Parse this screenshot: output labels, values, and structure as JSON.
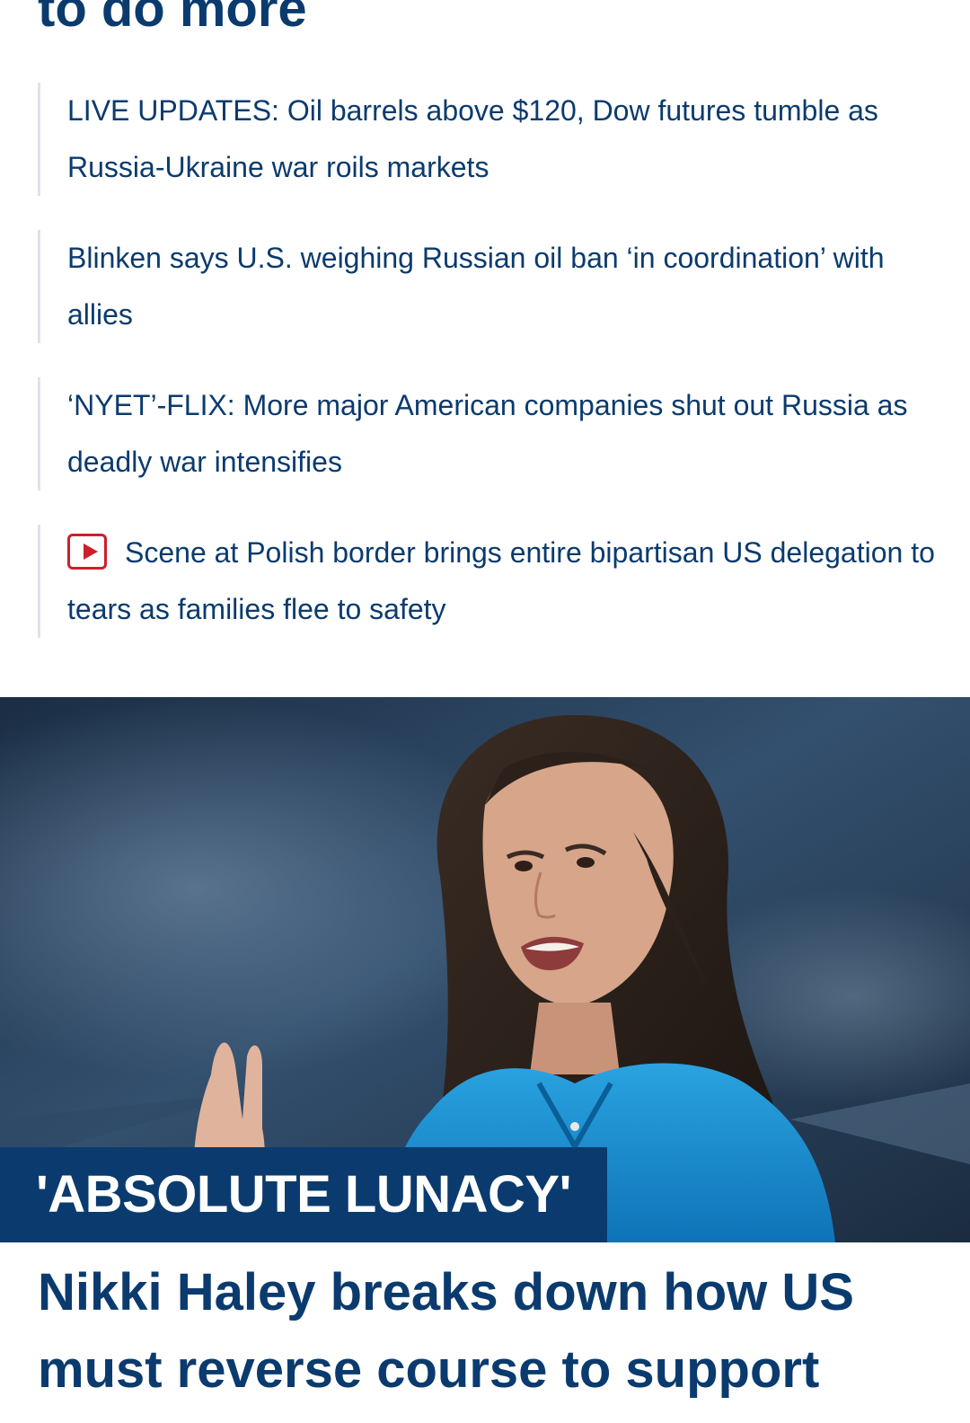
{
  "top_headline": "to do more",
  "related_links": [
    {
      "text": "LIVE UPDATES: Oil barrels above $120, Dow futures tumble as Russia-Ukraine war roils markets"
    },
    {
      "text": "Blinken says U.S. weighing Russian oil ban ‘in coordination’ with allies"
    },
    {
      "text": "‘NYET’-FLIX: More major American companies shut out Russia as deadly war intensifies"
    },
    {
      "text": "Scene at Polish border brings entire bipartisan US delegation to tears as families flee to safety",
      "icon": "video-play-icon"
    }
  ],
  "hero": {
    "kicker": "'ABSOLUTE LUNACY'"
  },
  "main_headline": "Nikki Haley breaks down how US must reverse course to support",
  "colors": {
    "brand_navy": "#0b3b6e",
    "video_red": "#cc1f2b",
    "rule_gray": "#dfe3e8"
  }
}
